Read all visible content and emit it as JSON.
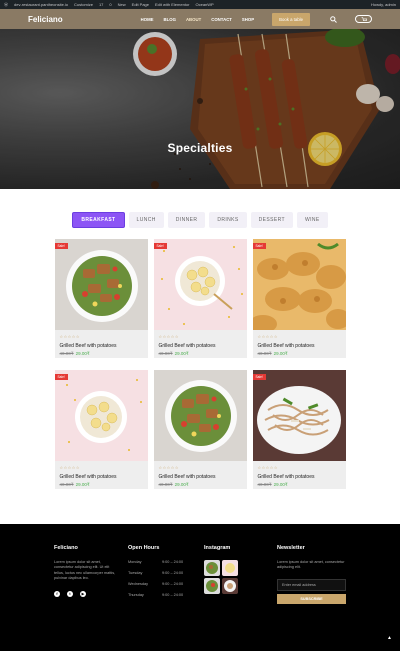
{
  "adminbar": {
    "site": "dev-restaurant.pantheonsite.io",
    "customize": "Customize",
    "comments": "17",
    "updates": "0",
    "new": "New",
    "edit_page": "Edit Page",
    "elementor": "Edit with Elementor",
    "ocean": "OceanWP",
    "howdy": "Howdy, admin"
  },
  "header": {
    "logo": "Feliciano",
    "nav": [
      "HOME",
      "BLOG",
      "ABOUT",
      "CONTACT",
      "SHOP"
    ],
    "book_label": "Book a table"
  },
  "hero": {
    "title": "Specialties"
  },
  "tabs": [
    "BREAKFAST",
    "LUNCH",
    "DINNER",
    "DRINKS",
    "DESSERT",
    "WINE"
  ],
  "products": [
    {
      "title": "Grilled Beef with potatoes",
      "old_price": "40.00₹",
      "new_price": "29.00₹",
      "badge": "Sale!"
    },
    {
      "title": "Grilled Beef with potatoes",
      "old_price": "40.00₹",
      "new_price": "29.00₹",
      "badge": "Sale!"
    },
    {
      "title": "Grilled Beef with potatoes",
      "old_price": "40.00₹",
      "new_price": "29.00₹",
      "badge": "Sale!"
    },
    {
      "title": "Grilled Beef with potatoes",
      "old_price": "40.00₹",
      "new_price": "29.00₹",
      "badge": "Sale!"
    },
    {
      "title": "Grilled Beef with potatoes",
      "old_price": "40.00₹",
      "new_price": "29.00₹",
      "badge": ""
    },
    {
      "title": "Grilled Beef with potatoes",
      "old_price": "40.00₹",
      "new_price": "29.00₹",
      "badge": "Sale!"
    }
  ],
  "stars": "☆☆☆☆☆",
  "footer": {
    "about_title": "Feliciano",
    "about_text": "Lorem ipsum dolor sit amet, consectetur adipiscing elit. Ut elit tellus, luctus nec ullamcorper mattis, pulvinar dapibus leo.",
    "hours_title": "Open Hours",
    "hours": [
      {
        "day": "Monday",
        "time": "9:00 – 24:00"
      },
      {
        "day": "Tuesday",
        "time": "9:00 – 24:00"
      },
      {
        "day": "Wednesday",
        "time": "9:00 – 24:00"
      },
      {
        "day": "Thursday",
        "time": "9:00 – 24:00"
      }
    ],
    "insta_title": "Instagram",
    "news_title": "Newsletter",
    "news_text": "Lorem ipsum dolor sit amet, consectetur adipiscing elit.",
    "email_placeholder": "Enter email address",
    "subscribe_label": "SUBSCRIBE"
  },
  "colors": {
    "accent": "#c9a66b",
    "tab_active": "#8c55f5",
    "sale": "#e53935",
    "price_new": "#4caf50"
  }
}
